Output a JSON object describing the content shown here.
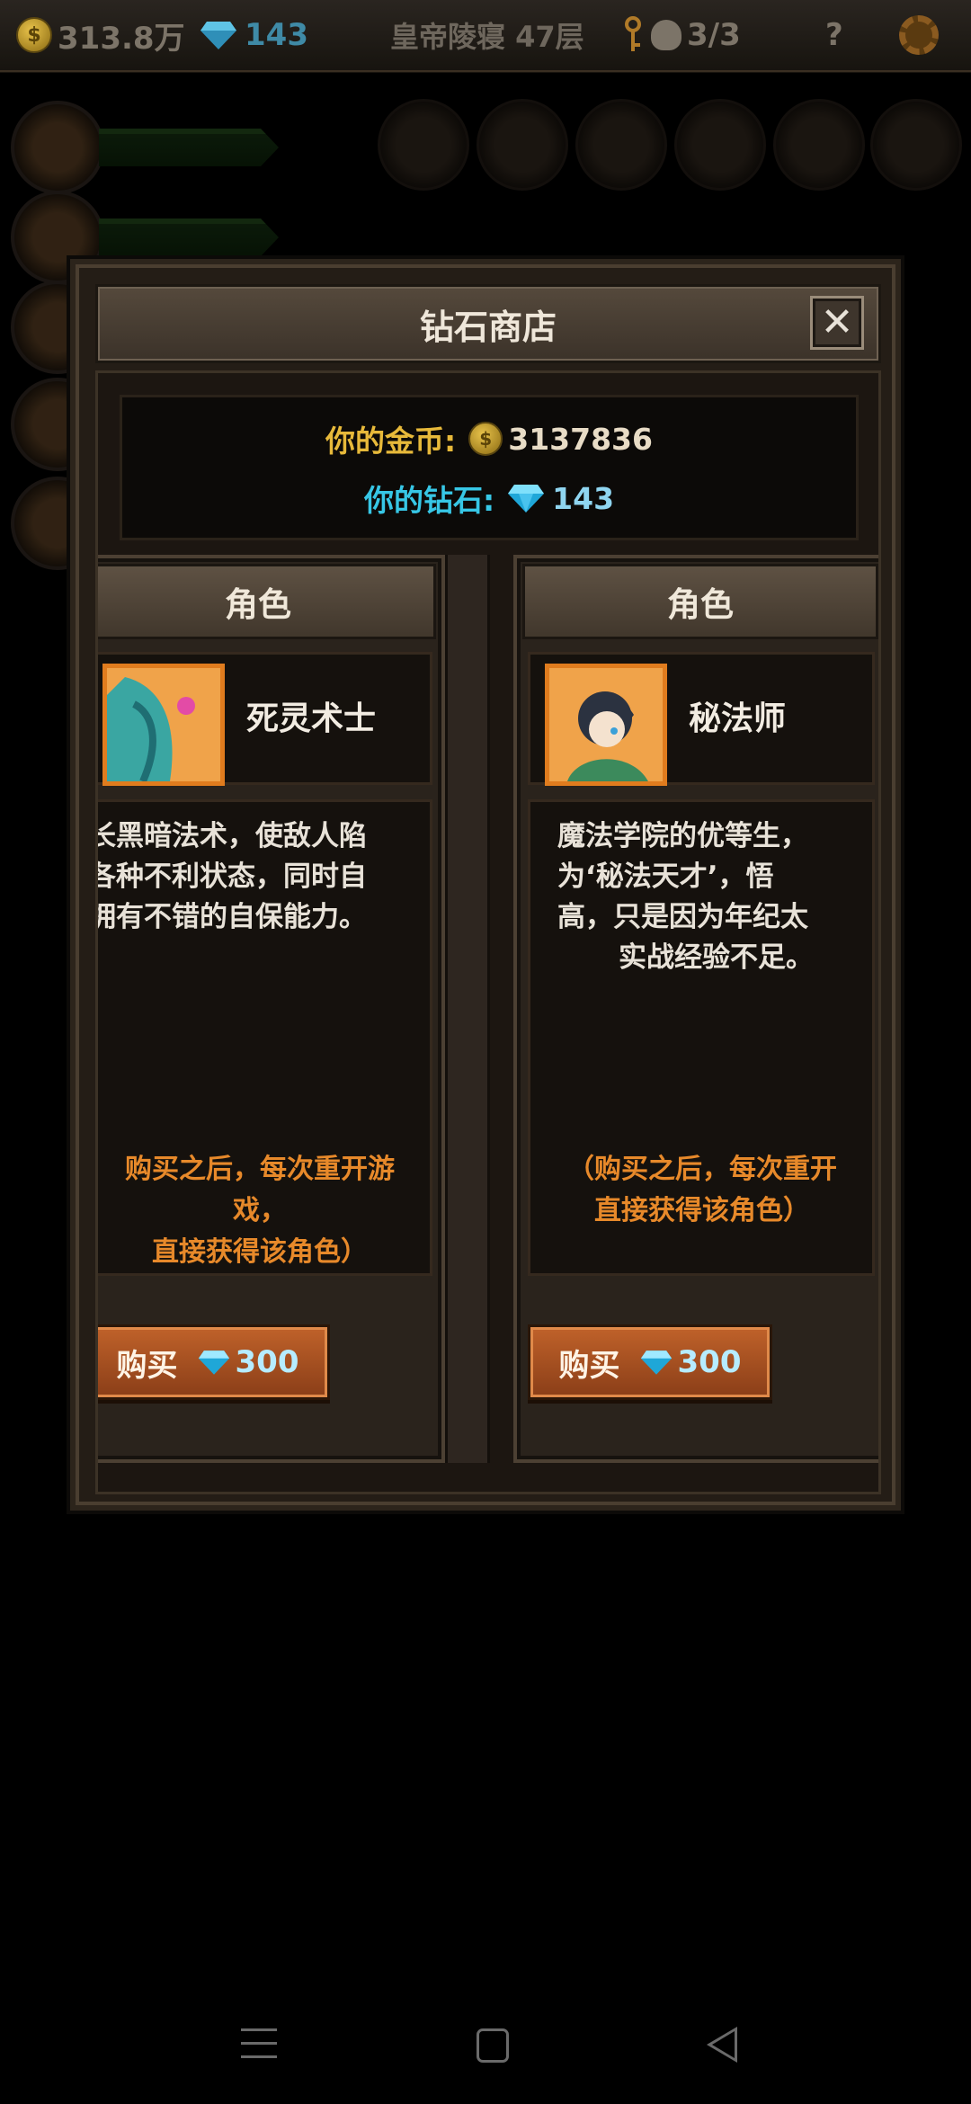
{
  "topbar": {
    "gold": "313.8万",
    "gems": "143",
    "floor": "皇帝陵寝 47层",
    "keys_skulls": "3/3",
    "help": "?"
  },
  "dialog": {
    "title": "钻石商店",
    "close": "✕",
    "wallet": {
      "gold_label": "你的金币:",
      "gold_value": "3137836",
      "gem_label": "你的钻石:",
      "gem_value": "143"
    },
    "cards": [
      {
        "category": "角色",
        "name": "死灵术士",
        "desc_lines": [
          "长黑暗法术，使敌人陷",
          "各种不利状态，同时自",
          "拥有不错的自保能力。"
        ],
        "note_lines": [
          "购买之后，每次重开游戏，",
          "直接获得该角色）"
        ],
        "buy_label": "购买",
        "price": "300"
      },
      {
        "category": "角色",
        "name": "秘法师",
        "desc_lines": [
          "魔法学院的优等生，",
          "为‘秘法天才’，悟",
          "高，只是因为年纪太",
          "实战经验不足。"
        ],
        "note_lines": [
          "（购买之后，每次重开",
          "直接获得该角色）"
        ],
        "buy_label": "购买",
        "price": "300"
      }
    ]
  },
  "colors": {
    "gold_label": "#e7b93a",
    "gem_label": "#37c7e6",
    "note": "#e7892a",
    "buy_button": "#b5582a",
    "portrait_border": "#e07c1e"
  }
}
